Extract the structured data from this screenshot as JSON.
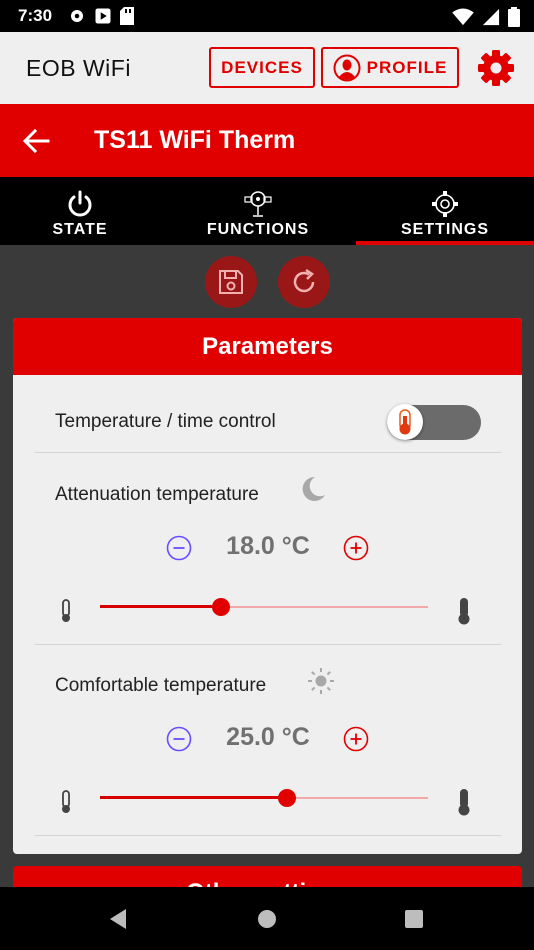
{
  "status_bar": {
    "time": "7:30"
  },
  "app_bar": {
    "title": "EOB WiFi",
    "devices_label": "DEVICES",
    "profile_label": "PROFILE",
    "settings_icon": "gear-icon"
  },
  "device": {
    "title": "TS11 WiFi Therm"
  },
  "tabs": [
    {
      "label": "STATE",
      "icon": "power-icon",
      "active": false
    },
    {
      "label": "FUNCTIONS",
      "icon": "functions-icon",
      "active": false
    },
    {
      "label": "SETTINGS",
      "icon": "gear-icon",
      "active": true
    }
  ],
  "parameters": {
    "title": "Parameters",
    "temp_time_control": {
      "label": "Temperature / time control",
      "enabled": false
    },
    "attenuation": {
      "label": "Attenuation temperature",
      "icon": "moon-icon",
      "value": "18.0 °C",
      "slider_fraction": 0.37
    },
    "comfortable": {
      "label": "Comfortable temperature",
      "icon": "sun-icon",
      "value": "25.0 °C",
      "slider_fraction": 0.57
    }
  },
  "next_card": {
    "title": "Other settings"
  },
  "colors": {
    "accent": "#e00000",
    "dark_accent": "#9a1717",
    "minus": "#6a4cff"
  }
}
